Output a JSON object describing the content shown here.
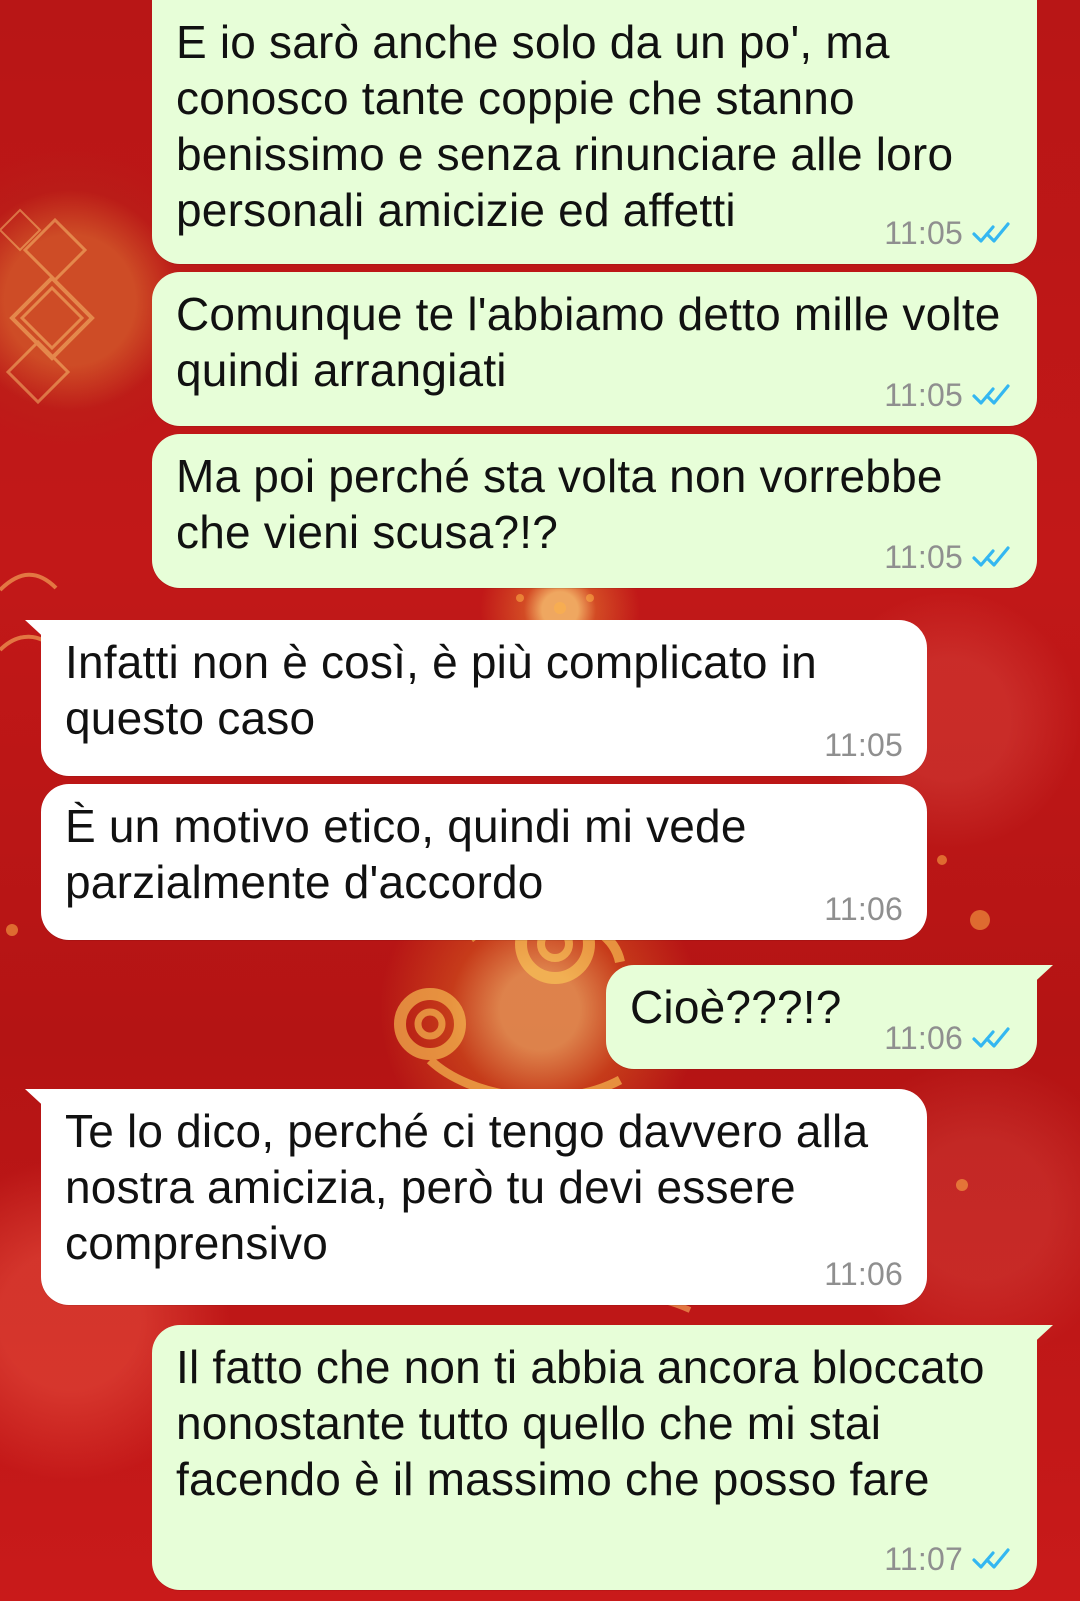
{
  "chat": {
    "messages": [
      {
        "direction": "out",
        "text": "E io sarò anche solo da un po', ma conosco tante coppie che stanno benissimo e senza rinunciare alle loro personali amicizie ed affetti",
        "time": "11:05",
        "status": "read",
        "tick_icon": "double-check-icon"
      },
      {
        "direction": "out",
        "text": "Comunque te l'abbiamo detto mille volte quindi arrangiati",
        "time": "11:05",
        "status": "read",
        "tick_icon": "double-check-icon"
      },
      {
        "direction": "out",
        "text": "Ma poi perché sta volta non vorrebbe che vieni scusa?!?",
        "time": "11:05",
        "status": "read",
        "tick_icon": "double-check-icon"
      },
      {
        "direction": "in",
        "text": "Infatti non è così, è più complicato in questo caso",
        "time": "11:05"
      },
      {
        "direction": "in",
        "text": "È un motivo etico, quindi mi vede parzialmente d'accordo",
        "time": "11:06"
      },
      {
        "direction": "out",
        "text": "Cioè???!?",
        "time": "11:06",
        "status": "read",
        "tick_icon": "double-check-icon"
      },
      {
        "direction": "in",
        "text": "Te lo dico, perché ci tengo davvero alla nostra amicizia, però tu devi essere comprensivo",
        "time": "11:06"
      },
      {
        "direction": "out",
        "text": "Il fatto che non ti abbia ancora bloccato nonostante tutto quello che mi stai facendo è il massimo che posso fare",
        "time": "11:07",
        "status": "read",
        "tick_icon": "double-check-icon"
      }
    ]
  },
  "colors": {
    "background_red": "#c21818",
    "outgoing_bubble": "#e7fed8",
    "incoming_bubble": "#ffffff",
    "timestamp_gray": "#8f8f8f",
    "read_tick_blue": "#34b7f1"
  }
}
